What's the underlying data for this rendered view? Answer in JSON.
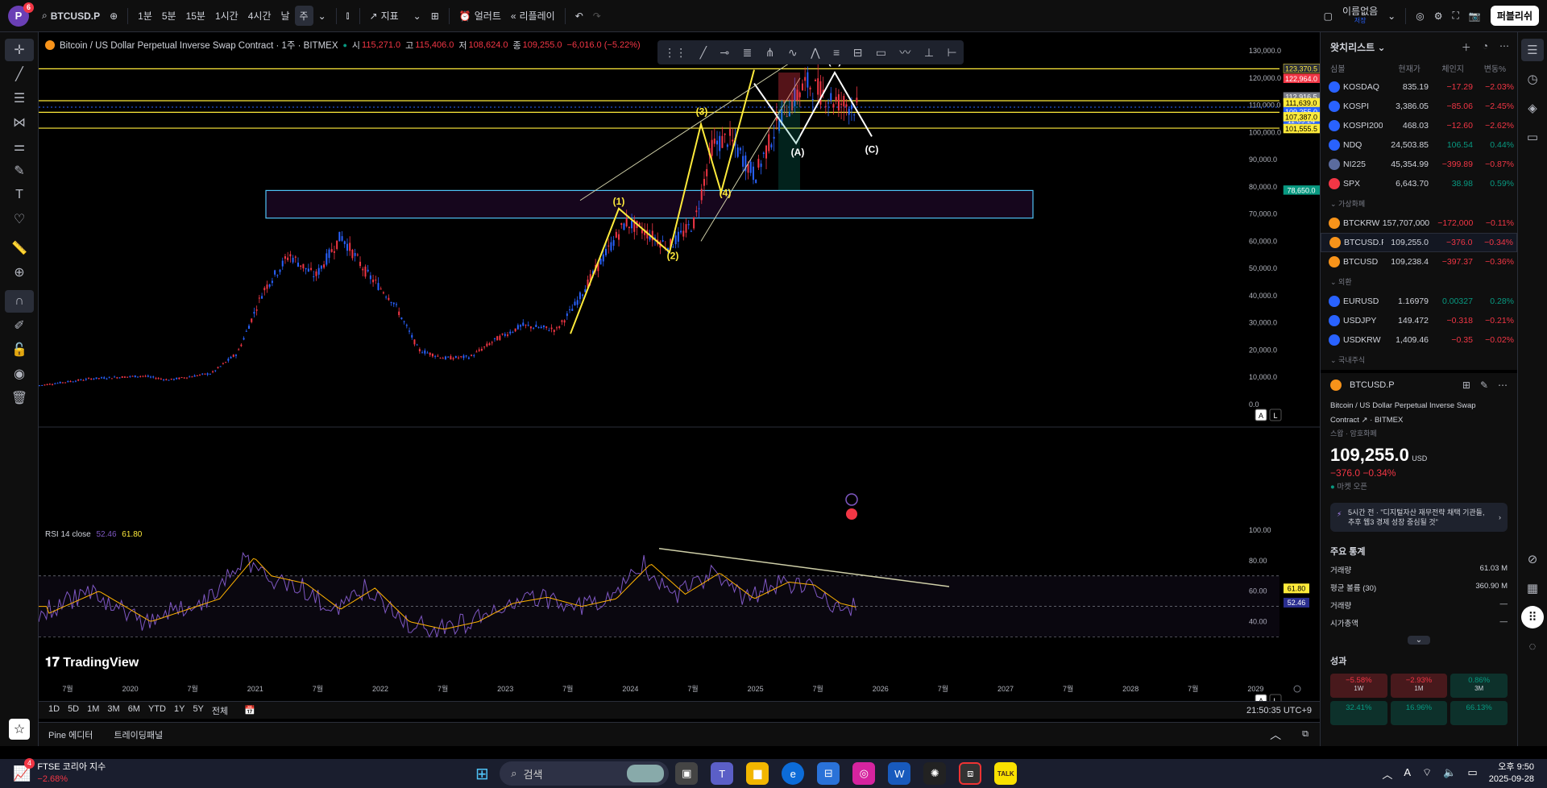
{
  "topbar": {
    "avatar_letter": "P",
    "avatar_badge": "6",
    "symbol": "BTCUSD.P",
    "intervals": [
      "1분",
      "5분",
      "15분",
      "1시간",
      "4시간",
      "날",
      "주"
    ],
    "active_interval": "주",
    "indicators_label": "지표",
    "alert_label": "얼러트",
    "replay_label": "리플레이",
    "layout_name": "이름없음",
    "layout_sub": "저장",
    "publish_label": "퍼블리쉬"
  },
  "legend": {
    "title": "Bitcoin / US Dollar Perpetual Inverse Swap Contract · 1주 · BITMEX",
    "open_label": "시",
    "open": "115,271.0",
    "high_label": "고",
    "high": "115,406.0",
    "low_label": "저",
    "low": "108,624.0",
    "close_label": "종",
    "close": "109,255.0",
    "change": "−6,016.0 (−5.22%)"
  },
  "price_axis": [
    "130,000.0",
    "120,000.0",
    "110,000.0",
    "100,000.0",
    "90,000.0",
    "80,000.0",
    "70,000.0",
    "60,000.0",
    "50,000.0",
    "40,000.0",
    "30,000.0",
    "20,000.0",
    "10,000.0",
    "0.0"
  ],
  "price_tags": [
    {
      "text": "123,370.5",
      "color": "#2a2e39",
      "fg": "#ffeb3b",
      "border": "#ffeb3b"
    },
    {
      "text": "122,964.0",
      "color": "#f23645",
      "fg": "#ffffff",
      "border": "#f23645"
    },
    {
      "text": "112,916.5",
      "color": "#787b86",
      "fg": "#ffffff",
      "border": "#787b86"
    },
    {
      "text": "111,639.0",
      "color": "#ffeb3b",
      "fg": "#000000",
      "border": "#ffeb3b"
    },
    {
      "text": "109,255.0",
      "color": "#2962ff",
      "fg": "#ffffff",
      "border": "#2962ff"
    },
    {
      "text": "11:09:24",
      "color": "#2962ff",
      "fg": "#ffffff",
      "border": "#2962ff"
    },
    {
      "text": "107,387.0",
      "color": "#ffeb3b",
      "fg": "#000000",
      "border": "#ffeb3b"
    },
    {
      "text": "101,555.5",
      "color": "#ffeb3b",
      "fg": "#000000",
      "border": "#ffeb3b"
    },
    {
      "text": "78,650.0",
      "color": "#089981",
      "fg": "#ffffff",
      "border": "#089981"
    }
  ],
  "wave_labels": {
    "w1": "(1)",
    "w2": "(2)",
    "w3": "(3)",
    "w4": "(4)",
    "w5": "(5)",
    "wa": "(A)",
    "wb": "(B)",
    "wc": "(C)"
  },
  "rsi": {
    "label": "RSI 14 close",
    "value1": "52.46",
    "value2": "61.80",
    "axis": [
      "100.00",
      "80.00",
      "60.00",
      "40.00"
    ],
    "tag1": "61.80",
    "tag2": "52.46"
  },
  "brand": "TradingView",
  "time_axis": [
    "7월",
    "2020",
    "7월",
    "2021",
    "7월",
    "2022",
    "7월",
    "2023",
    "7월",
    "2024",
    "7월",
    "2025",
    "7월",
    "2026",
    "7월",
    "2027",
    "7월",
    "2028",
    "7월",
    "2029"
  ],
  "range_buttons": [
    "1D",
    "5D",
    "1M",
    "3M",
    "6M",
    "YTD",
    "1Y",
    "5Y",
    "전체"
  ],
  "clock": "21:50:35 UTC+9",
  "bottom_tabs": [
    "Pine 에디터",
    "트레이딩패널"
  ],
  "scale_buttons": {
    "auto": "A",
    "log": "L"
  },
  "watchlist": {
    "title": "왓치리스트",
    "cols": [
      "심볼",
      "현재가",
      "체인지",
      "변동%"
    ],
    "groups": [
      {
        "name": "",
        "rows": [
          {
            "sym": "KOSDAQ",
            "price": "835.19",
            "chg": "−17.29",
            "pct": "−2.03%",
            "dir": "neg",
            "ic": "#2962ff"
          },
          {
            "sym": "KOSPI",
            "price": "3,386.05",
            "chg": "−85.06",
            "pct": "−2.45%",
            "dir": "neg",
            "ic": "#2962ff"
          },
          {
            "sym": "KOSPI200",
            "price": "468.03",
            "chg": "−12.60",
            "pct": "−2.62%",
            "dir": "neg",
            "ic": "#2962ff"
          },
          {
            "sym": "NDQ",
            "price": "24,503.85",
            "chg": "106.54",
            "pct": "0.44%",
            "dir": "pos",
            "ic": "#2962ff"
          },
          {
            "sym": "NI225",
            "price": "45,354.99",
            "chg": "−399.89",
            "pct": "−0.87%",
            "dir": "neg",
            "ic": "#5b6b9e"
          },
          {
            "sym": "SPX",
            "price": "6,643.70",
            "chg": "38.98",
            "pct": "0.59%",
            "dir": "pos",
            "ic": "#f23645"
          }
        ]
      },
      {
        "name": "가상화폐",
        "rows": [
          {
            "sym": "BTCKRW",
            "price": "157,707,000",
            "chg": "−172,000",
            "pct": "−0.11%",
            "dir": "neg",
            "ic": "#f7931a"
          },
          {
            "sym": "BTCUSD.P",
            "price": "109,255.0",
            "chg": "−376.0",
            "pct": "−0.34%",
            "dir": "neg",
            "ic": "#f7931a",
            "sel": true
          },
          {
            "sym": "BTCUSD",
            "price": "109,238.4",
            "chg": "−397.37",
            "pct": "−0.36%",
            "dir": "neg",
            "ic": "#f7931a"
          }
        ]
      },
      {
        "name": "외환",
        "rows": [
          {
            "sym": "EURUSD",
            "price": "1.16979",
            "chg": "0.00327",
            "pct": "0.28%",
            "dir": "pos",
            "ic": "#2962ff"
          },
          {
            "sym": "USDJPY",
            "price": "149.472",
            "chg": "−0.318",
            "pct": "−0.21%",
            "dir": "neg",
            "ic": "#2962ff"
          },
          {
            "sym": "USDKRW",
            "price": "1,409.46",
            "chg": "−0.35",
            "pct": "−0.02%",
            "dir": "neg",
            "ic": "#2962ff"
          }
        ]
      },
      {
        "name": "국내주식",
        "rows": []
      }
    ]
  },
  "detail": {
    "symbol": "BTCUSD.P",
    "name": "Bitcoin / US Dollar Perpetual Inverse Swap Contract",
    "exchange": "BITMEX",
    "category": "스왑 · 암호화폐",
    "price": "109,255.0",
    "currency": "USD",
    "change": "−376.0",
    "change_pct": "−0.34%",
    "market_status": "마켓 오픈",
    "news": "5시간 전 · \"디지털자산 재무전략 채택 기관들, 추후 웹3 경제 성장 중심될 것\"",
    "stats_title": "주요 통계",
    "stats": [
      {
        "k": "거래량",
        "v": "61.03 M"
      },
      {
        "k": "평균 볼륨 (30)",
        "v": "360.90 M"
      },
      {
        "k": "거래량",
        "v": "—"
      },
      {
        "k": "시가총액",
        "v": "—"
      }
    ],
    "perf_title": "성과",
    "perf": [
      {
        "v": "−5.58%",
        "p": "1W",
        "dir": "neg"
      },
      {
        "v": "−2.93%",
        "p": "1M",
        "dir": "neg"
      },
      {
        "v": "0.86%",
        "p": "3M",
        "dir": "pos"
      },
      {
        "v": "32.41%",
        "p": "",
        "dir": "pos"
      },
      {
        "v": "16.96%",
        "p": "",
        "dir": "pos"
      },
      {
        "v": "66.13%",
        "p": "",
        "dir": "pos"
      }
    ]
  },
  "taskbar": {
    "widget_title": "FTSE 코리아 지수",
    "widget_value": "−2.68%",
    "widget_badge": "4",
    "search_label": "검색",
    "time": "오후 9:50",
    "date": "2025-09-28",
    "kakao": "TALK"
  },
  "colors": {
    "up": "#089981",
    "down": "#f23645",
    "accent": "#2962ff",
    "wave": "#ffeb3b",
    "zone": "#4fc3f7"
  }
}
